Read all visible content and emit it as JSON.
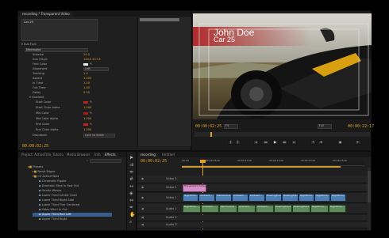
{
  "effect_controls": {
    "title": "recording * Transparent Video",
    "text_box": "Car 25",
    "section_sub_font": "Sub Font",
    "preset_value": "Minimalist",
    "props": [
      {
        "label": "Subsize",
        "value": "24.0"
      },
      {
        "label": "Sub Origin",
        "value": "140.0    417.6"
      },
      {
        "label": "Font Color",
        "value": ""
      },
      {
        "label": "Alignment",
        "value": "Left"
      },
      {
        "label": "Tracking",
        "value": "1.0"
      },
      {
        "label": "Aspect",
        "value": "1.000"
      },
      {
        "label": "In Time",
        "value": "1.00"
      },
      {
        "label": "Out Time",
        "value": "1.00"
      },
      {
        "label": "Delay",
        "value": "0.50"
      }
    ],
    "section_gradient": "Gradient",
    "gradient_props": [
      {
        "label": "Start Color",
        "value": ""
      },
      {
        "label": "Start Color alpha",
        "value": "1.000"
      },
      {
        "label": "Mid Color",
        "value": ""
      },
      {
        "label": "Mid Color alpha",
        "value": "1.000"
      },
      {
        "label": "End Color",
        "value": ""
      },
      {
        "label": "End Color alpha",
        "value": "1.000"
      }
    ],
    "dropdown_label": "Dropdown",
    "dropdown_value": "Lock to Scale",
    "timecode": "00:00:02:25"
  },
  "program": {
    "title_name": "John Doe",
    "title_sub": "Car 25",
    "timecode_left": "00:00:02:25",
    "timecode_right": "00:00:22:17",
    "fit": "Fit",
    "quality": "Full"
  },
  "project": {
    "tabs": [
      "Project: ActiveTitle_TutorialU",
      "Media Browser",
      "Info",
      "Effects"
    ],
    "search_value": "",
    "items": [
      {
        "label": "Presets",
        "level": 0
      },
      {
        "label": "Bevel Edges",
        "level": 1
      },
      {
        "label": "CZ ActiveTitles",
        "level": 1
      },
      {
        "label": "Chromatic Ripple",
        "level": 2
      },
      {
        "label": "Dramatic Slice In Fast Out",
        "level": 2
      },
      {
        "label": "Gentle Waves",
        "level": 2
      },
      {
        "label": "Lower Third Center Grad",
        "level": 2
      },
      {
        "label": "Lower Third Right Side",
        "level": 2
      },
      {
        "label": "Lower Third Trim Centered",
        "level": 2
      },
      {
        "label": "Sides Whirl In Out",
        "level": 2
      },
      {
        "label": "Upper Third Red Left",
        "level": 2
      },
      {
        "label": "Upper Third Right",
        "level": 2
      }
    ],
    "selected_index": 10
  },
  "timeline": {
    "tabs": [
      "recording",
      "Untitled"
    ],
    "timecode": "00:00:02:25",
    "ruler": [
      "00:00",
      "00:00:05:00",
      "00:00:10:00",
      "00:00:15:00",
      "00:00:20:00",
      "00:00:25:00"
    ],
    "tracks": [
      {
        "label": "Video 3"
      },
      {
        "label": "Video 2"
      },
      {
        "label": "Video 1"
      },
      {
        "label": "Audio 1"
      },
      {
        "label": "Audio 2"
      },
      {
        "label": "Audio 3"
      }
    ],
    "title_clip": "Transparent Video",
    "clips_v1": [
      "Nighttime...",
      "Ambient...",
      "Mechanical...",
      "Ambient...",
      "Ambient...",
      "BowlingTrack...",
      "BowlingTrack...",
      "Nighttime...",
      "Nighttime...",
      "Nighttime..."
    ],
    "clips_a1": [
      "Nighttime...",
      "Ambient...",
      "Mechanical...",
      "Ambient...",
      "Ambient...",
      "BowlingTrack...",
      "BowlingTrack...",
      "Nighttime...",
      "Nighttime..."
    ]
  }
}
